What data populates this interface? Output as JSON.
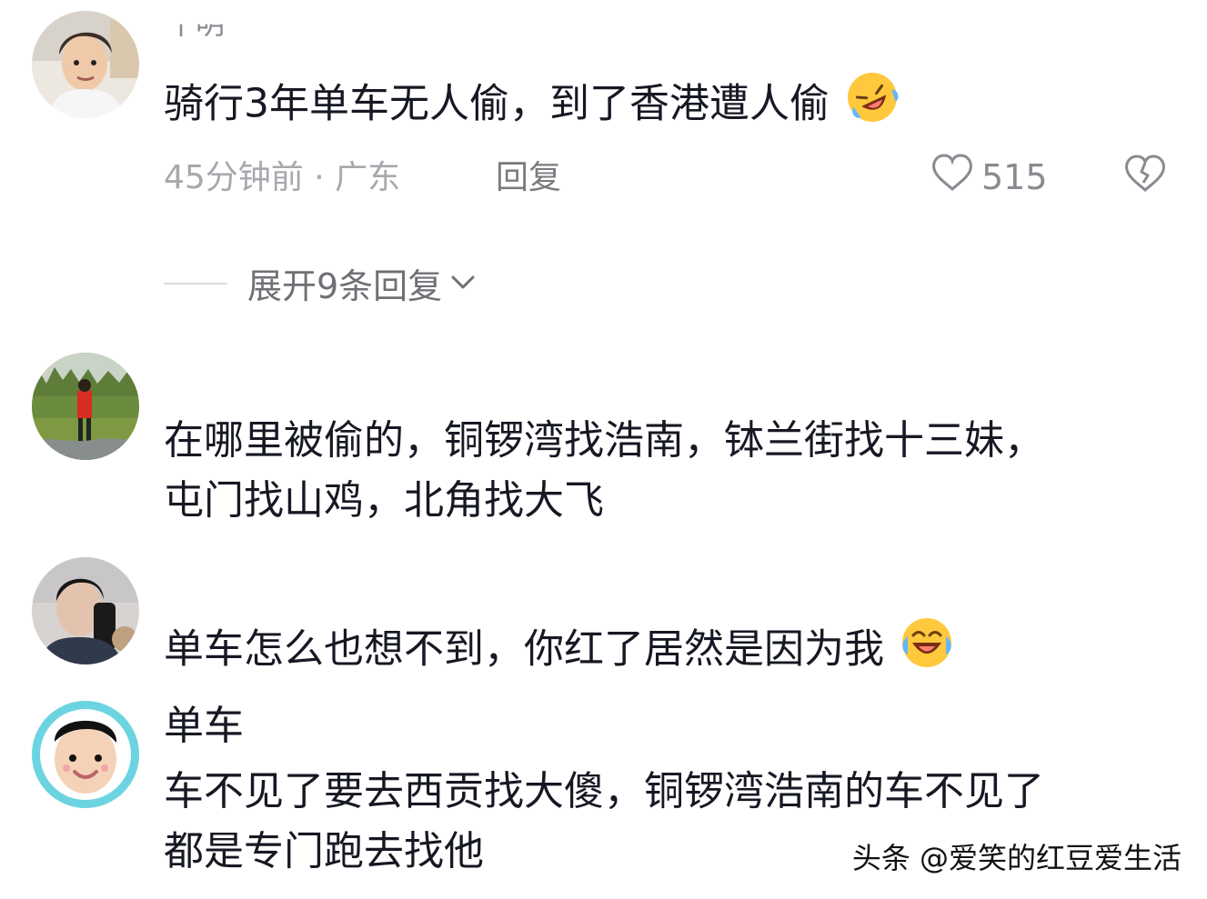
{
  "comments": [
    {
      "username": "十明",
      "text": "骑行3年单车无人偷，到了香港遭人偷",
      "emoji": "rofl-emoji",
      "time": "45分钟前",
      "location": "广东",
      "meta": "45分钟前 · 广东",
      "reply_label": "回复",
      "likes": "515",
      "expand_label": "展开9条回复"
    },
    {
      "text_line1": "在哪里被偷的，铜锣湾找浩南，钵兰街找十三妹，",
      "text_line2": "屯门找山鸡，北角找大飞"
    },
    {
      "text": "单车怎么也想不到，你红了居然是因为我",
      "emoji": "laughing-tears-emoji"
    },
    {
      "username": "单车",
      "text_line1": "车不见了要去西贡找大傻，铜锣湾浩南的车不见了",
      "text_line2": "都是专门跑去找他"
    }
  ],
  "watermark": "头条 @爱笑的红豆爱生活",
  "colors": {
    "primary_text": "#161823",
    "secondary_text": "#a7a8ad",
    "emoji_yellow": "#ffc83d"
  }
}
